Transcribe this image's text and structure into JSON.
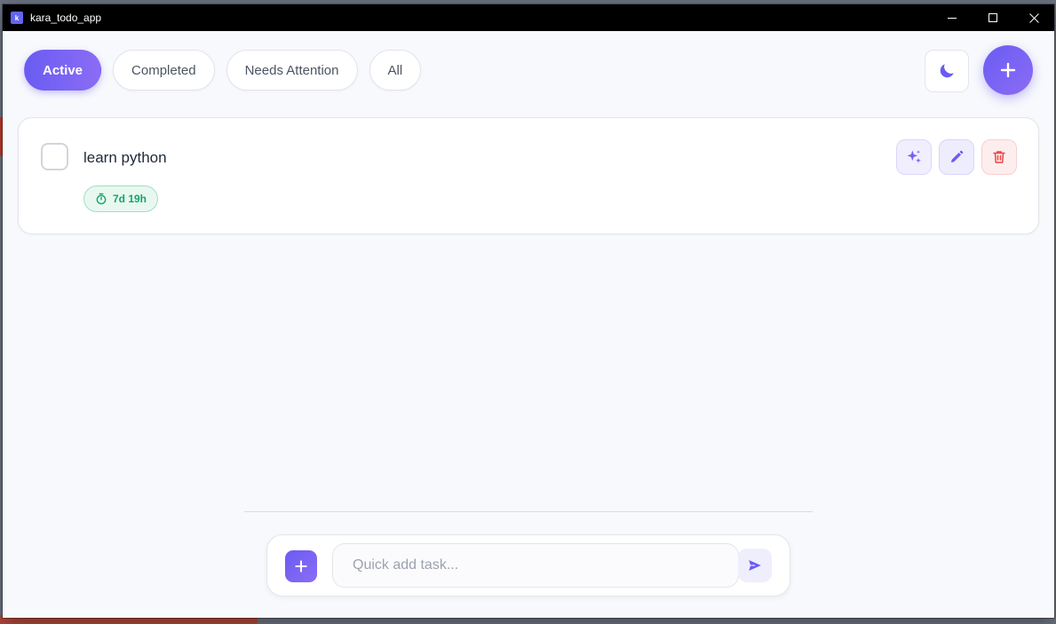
{
  "window": {
    "title": "kara_todo_app",
    "icon_label": "k"
  },
  "filters": [
    {
      "label": "Active",
      "selected": true
    },
    {
      "label": "Completed",
      "selected": false
    },
    {
      "label": "Needs Attention",
      "selected": false
    },
    {
      "label": "All",
      "selected": false
    }
  ],
  "header": {
    "theme_icon": "moon-icon",
    "add_icon": "plus-icon"
  },
  "tasks": [
    {
      "title": "learn python",
      "completed": false,
      "time_remaining": "7d 19h",
      "actions": [
        "sparkle-icon",
        "pencil-icon",
        "trash-icon"
      ]
    }
  ],
  "quick_add": {
    "placeholder": "Quick add task...",
    "value": ""
  },
  "colors": {
    "accent": "#6a5cf2",
    "accent_light": "#8b6cf5",
    "success": "#16a36b",
    "danger": "#ef4444",
    "background": "#f8f9fc"
  }
}
